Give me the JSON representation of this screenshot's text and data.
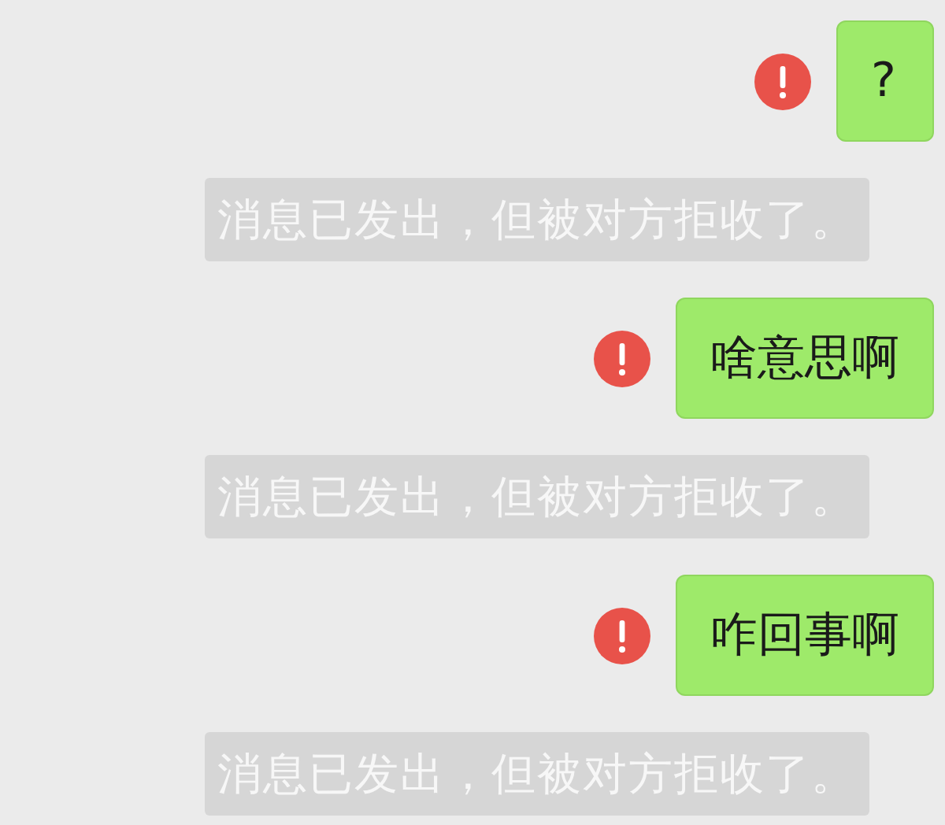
{
  "messages": [
    {
      "kind": "bubble",
      "text": "?",
      "failed": true
    },
    {
      "kind": "notice",
      "text": "消息已发出，但被对方拒收了。"
    },
    {
      "kind": "bubble",
      "text": "啥意思啊",
      "failed": true
    },
    {
      "kind": "notice",
      "text": "消息已发出，但被对方拒收了。"
    },
    {
      "kind": "bubble",
      "text": "咋回事啊",
      "failed": true
    },
    {
      "kind": "notice",
      "text": "消息已发出，但被对方拒收了。"
    }
  ]
}
